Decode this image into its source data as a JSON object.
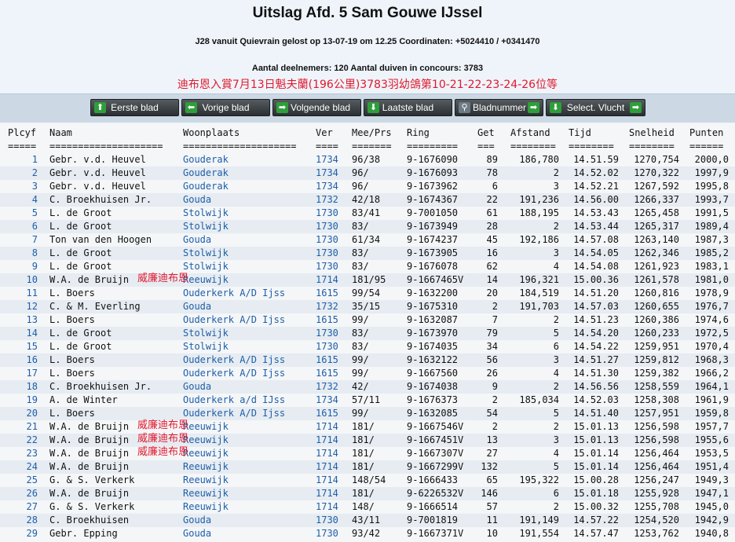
{
  "header": {
    "title": "Uitslag Afd. 5 Sam Gouwe IJssel",
    "line1": "J28 vanuit Quievrain gelost op 13-07-19 om 12.25 Coordinaten: +5024410 / +0341470",
    "line2": "Aantal deelnemers: 120 Aantal duiven in concours: 3783",
    "chinese_headline": "迪布恩入賞7月13日魁夫蘭(196公里)3783羽幼鴿第10-21-22-23-24-26位等"
  },
  "toolbar": {
    "buttons": [
      {
        "label": "Eerste blad",
        "icon": "up-arrow-icon"
      },
      {
        "label": "Vorige blad",
        "icon": "left-arrow-icon"
      },
      {
        "label": "Volgende blad",
        "icon": "right-arrow-icon"
      },
      {
        "label": "Laatste blad",
        "icon": "down-arrow-icon"
      },
      {
        "label": "Bladnummer",
        "icon": "magnifier-icon"
      },
      {
        "label": "Select. Vlucht",
        "icon": "download-icon"
      }
    ]
  },
  "table": {
    "columns": [
      "Plcyf",
      "Naam",
      "Woonplaats",
      "Ver",
      "Mee/Prs",
      "Ring",
      "Get",
      "Afstand",
      "Tijd",
      "Snelheid",
      "Punten"
    ],
    "dashes": [
      "=====",
      "====================",
      "====================",
      "====",
      "=======",
      "=========",
      "===",
      "========",
      "========",
      "========",
      "======"
    ],
    "rows": [
      {
        "place": "1",
        "name": "Gebr. v.d. Heuvel",
        "woon": "Gouderak",
        "ver": "1734",
        "mee": "96/38",
        "ring": "9-1676090",
        "get": "89",
        "afs": "186,780",
        "tijd": "14.51.59",
        "snel": "1270,754",
        "pnt": "2000,0"
      },
      {
        "place": "2",
        "name": "Gebr. v.d. Heuvel",
        "woon": "Gouderak",
        "ver": "1734",
        "mee": "96/",
        "ring": "9-1676093",
        "get": "78",
        "afs": "2",
        "tijd": "14.52.02",
        "snel": "1270,322",
        "pnt": "1997,9"
      },
      {
        "place": "3",
        "name": "Gebr. v.d. Heuvel",
        "woon": "Gouderak",
        "ver": "1734",
        "mee": "96/",
        "ring": "9-1673962",
        "get": "6",
        "afs": "3",
        "tijd": "14.52.21",
        "snel": "1267,592",
        "pnt": "1995,8"
      },
      {
        "place": "4",
        "name": "C. Broekhuisen Jr.",
        "woon": "Gouda",
        "ver": "1732",
        "mee": "42/18",
        "ring": "9-1674367",
        "get": "22",
        "afs": "191,236",
        "tijd": "14.56.00",
        "snel": "1266,337",
        "pnt": "1993,7"
      },
      {
        "place": "5",
        "name": "L. de Groot",
        "woon": "Stolwijk",
        "ver": "1730",
        "mee": "83/41",
        "ring": "9-7001050",
        "get": "61",
        "afs": "188,195",
        "tijd": "14.53.43",
        "snel": "1265,458",
        "pnt": "1991,5"
      },
      {
        "place": "6",
        "name": "L. de Groot",
        "woon": "Stolwijk",
        "ver": "1730",
        "mee": "83/",
        "ring": "9-1673949",
        "get": "28",
        "afs": "2",
        "tijd": "14.53.44",
        "snel": "1265,317",
        "pnt": "1989,4"
      },
      {
        "place": "7",
        "name": "Ton van den Hoogen",
        "woon": "Gouda",
        "ver": "1730",
        "mee": "61/34",
        "ring": "9-1674237",
        "get": "45",
        "afs": "192,186",
        "tijd": "14.57.08",
        "snel": "1263,140",
        "pnt": "1987,3"
      },
      {
        "place": "8",
        "name": "L. de Groot",
        "woon": "Stolwijk",
        "ver": "1730",
        "mee": "83/",
        "ring": "9-1673905",
        "get": "16",
        "afs": "3",
        "tijd": "14.54.05",
        "snel": "1262,346",
        "pnt": "1985,2"
      },
      {
        "place": "9",
        "name": "L. de Groot",
        "woon": "Stolwijk",
        "ver": "1730",
        "mee": "83/",
        "ring": "9-1676078",
        "get": "62",
        "afs": "4",
        "tijd": "14.54.08",
        "snel": "1261,923",
        "pnt": "1983,1"
      },
      {
        "place": "10",
        "name": "W.A. de Bruijn",
        "woon": "Reeuwijk",
        "ver": "1714",
        "mee": "181/95",
        "ring": "9-1667465V",
        "get": "14",
        "afs": "196,321",
        "tijd": "15.00.36",
        "snel": "1261,578",
        "pnt": "1981,0",
        "note": "威廉迪布恩"
      },
      {
        "place": "11",
        "name": "L. Boers",
        "woon": "Ouderkerk A/D Ijss",
        "ver": "1615",
        "mee": "99/54",
        "ring": "9-1632200",
        "get": "20",
        "afs": "184,519",
        "tijd": "14.51.20",
        "snel": "1260,816",
        "pnt": "1978,9"
      },
      {
        "place": "12",
        "name": "C. & M. Everling",
        "woon": "Gouda",
        "ver": "1732",
        "mee": "35/15",
        "ring": "9-1675310",
        "get": "2",
        "afs": "191,703",
        "tijd": "14.57.03",
        "snel": "1260,655",
        "pnt": "1976,7"
      },
      {
        "place": "13",
        "name": "L. Boers",
        "woon": "Ouderkerk A/D Ijss",
        "ver": "1615",
        "mee": "99/",
        "ring": "9-1632087",
        "get": "7",
        "afs": "2",
        "tijd": "14.51.23",
        "snel": "1260,386",
        "pnt": "1974,6"
      },
      {
        "place": "14",
        "name": "L. de Groot",
        "woon": "Stolwijk",
        "ver": "1730",
        "mee": "83/",
        "ring": "9-1673970",
        "get": "79",
        "afs": "5",
        "tijd": "14.54.20",
        "snel": "1260,233",
        "pnt": "1972,5"
      },
      {
        "place": "15",
        "name": "L. de Groot",
        "woon": "Stolwijk",
        "ver": "1730",
        "mee": "83/",
        "ring": "9-1674035",
        "get": "34",
        "afs": "6",
        "tijd": "14.54.22",
        "snel": "1259,951",
        "pnt": "1970,4"
      },
      {
        "place": "16",
        "name": "L. Boers",
        "woon": "Ouderkerk A/D Ijss",
        "ver": "1615",
        "mee": "99/",
        "ring": "9-1632122",
        "get": "56",
        "afs": "3",
        "tijd": "14.51.27",
        "snel": "1259,812",
        "pnt": "1968,3"
      },
      {
        "place": "17",
        "name": "L. Boers",
        "woon": "Ouderkerk A/D Ijss",
        "ver": "1615",
        "mee": "99/",
        "ring": "9-1667560",
        "get": "26",
        "afs": "4",
        "tijd": "14.51.30",
        "snel": "1259,382",
        "pnt": "1966,2"
      },
      {
        "place": "18",
        "name": "C. Broekhuisen Jr.",
        "woon": "Gouda",
        "ver": "1732",
        "mee": "42/",
        "ring": "9-1674038",
        "get": "9",
        "afs": "2",
        "tijd": "14.56.56",
        "snel": "1258,559",
        "pnt": "1964,1"
      },
      {
        "place": "19",
        "name": "A. de Winter",
        "woon": "Ouderkerk a/d IJss",
        "ver": "1734",
        "mee": "57/11",
        "ring": "9-1676373",
        "get": "2",
        "afs": "185,034",
        "tijd": "14.52.03",
        "snel": "1258,308",
        "pnt": "1961,9"
      },
      {
        "place": "20",
        "name": "L. Boers",
        "woon": "Ouderkerk A/D Ijss",
        "ver": "1615",
        "mee": "99/",
        "ring": "9-1632085",
        "get": "54",
        "afs": "5",
        "tijd": "14.51.40",
        "snel": "1257,951",
        "pnt": "1959,8"
      },
      {
        "place": "21",
        "name": "W.A. de Bruijn",
        "woon": "Reeuwijk",
        "ver": "1714",
        "mee": "181/",
        "ring": "9-1667546V",
        "get": "2",
        "afs": "2",
        "tijd": "15.01.13",
        "snel": "1256,598",
        "pnt": "1957,7",
        "note": "威廉迪布恩"
      },
      {
        "place": "22",
        "name": "W.A. de Bruijn",
        "woon": "Reeuwijk",
        "ver": "1714",
        "mee": "181/",
        "ring": "9-1667451V",
        "get": "13",
        "afs": "3",
        "tijd": "15.01.13",
        "snel": "1256,598",
        "pnt": "1955,6",
        "note": "威廉迪布恩"
      },
      {
        "place": "23",
        "name": "W.A. de Bruijn",
        "woon": "Reeuwijk",
        "ver": "1714",
        "mee": "181/",
        "ring": "9-1667307V",
        "get": "27",
        "afs": "4",
        "tijd": "15.01.14",
        "snel": "1256,464",
        "pnt": "1953,5",
        "note": "威廉迪布恩"
      },
      {
        "place": "24",
        "name": "W.A. de Bruijn",
        "woon": "Reeuwijk",
        "ver": "1714",
        "mee": "181/",
        "ring": "9-1667299V",
        "get": "132",
        "afs": "5",
        "tijd": "15.01.14",
        "snel": "1256,464",
        "pnt": "1951,4"
      },
      {
        "place": "25",
        "name": "G. & S. Verkerk",
        "woon": "Reeuwijk",
        "ver": "1714",
        "mee": "148/54",
        "ring": "9-1666433",
        "get": "65",
        "afs": "195,322",
        "tijd": "15.00.28",
        "snel": "1256,247",
        "pnt": "1949,3"
      },
      {
        "place": "26",
        "name": "W.A. de Bruijn",
        "woon": "Reeuwijk",
        "ver": "1714",
        "mee": "181/",
        "ring": "9-6226532V",
        "get": "146",
        "afs": "6",
        "tijd": "15.01.18",
        "snel": "1255,928",
        "pnt": "1947,1"
      },
      {
        "place": "27",
        "name": "G. & S. Verkerk",
        "woon": "Reeuwijk",
        "ver": "1714",
        "mee": "148/",
        "ring": "9-1666514",
        "get": "57",
        "afs": "2",
        "tijd": "15.00.32",
        "snel": "1255,708",
        "pnt": "1945,0"
      },
      {
        "place": "28",
        "name": "C. Broekhuisen",
        "woon": "Gouda",
        "ver": "1730",
        "mee": "43/11",
        "ring": "9-7001819",
        "get": "11",
        "afs": "191,149",
        "tijd": "14.57.22",
        "snel": "1254,520",
        "pnt": "1942,9"
      },
      {
        "place": "29",
        "name": "Gebr. Epping",
        "woon": "Gouda",
        "ver": "1730",
        "mee": "93/42",
        "ring": "9-1667371V",
        "get": "10",
        "afs": "191,554",
        "tijd": "14.57.47",
        "snel": "1253,762",
        "pnt": "1940,8"
      }
    ]
  }
}
